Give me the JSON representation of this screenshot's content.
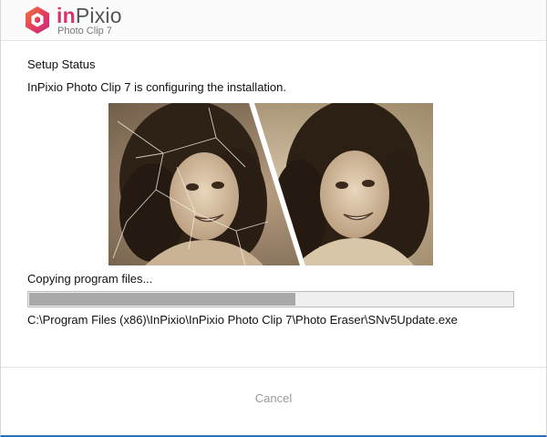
{
  "window": {
    "brand_accent": "in",
    "brand_rest": "Pixio",
    "subtitle": "Photo Clip 7"
  },
  "content": {
    "heading": "Setup Status",
    "message": "InPixio Photo Clip 7 is configuring the installation.",
    "status": "Copying program files...",
    "progress_fraction": 0.55,
    "file_path": "C:\\Program Files (x86)\\InPixio\\InPixio Photo Clip 7\\Photo Eraser\\SNv5Update.exe"
  },
  "footer": {
    "cancel_label": "Cancel"
  },
  "colors": {
    "brand_pink": "#d8326b",
    "brand_orange": "#f07a3a",
    "progress_fill": "#a8a8a8",
    "cancel_text": "#9a9a9a",
    "bottom_border": "#2b6fb7"
  },
  "icons": {
    "logo": "inpixio-hexagon-logo-icon"
  }
}
